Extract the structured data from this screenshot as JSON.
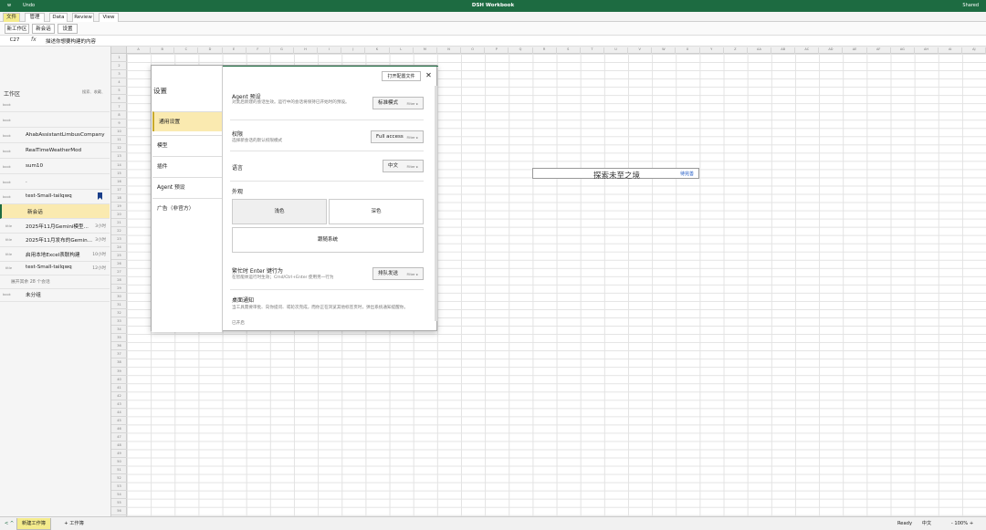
{
  "titlebar": {
    "left": "w",
    "undo": "Undo",
    "title": "DSH Workbook",
    "shared": "Shared"
  },
  "menu": [
    "文件",
    "管理",
    "Data",
    "Review",
    "View"
  ],
  "toolbar": [
    "新工作区",
    "新会话",
    "设置"
  ],
  "formula": {
    "cell": "C27",
    "fx": "fx",
    "text": "描述你想要构建的内容"
  },
  "columns": [
    "A",
    "B",
    "C",
    "D",
    "E",
    "F",
    "G",
    "H",
    "I",
    "J",
    "K",
    "L",
    "M",
    "N",
    "O",
    "P",
    "Q",
    "R",
    "S",
    "T",
    "U",
    "V",
    "W",
    "X",
    "Y",
    "Z",
    "AA",
    "AB",
    "AC",
    "AD",
    "AE",
    "AF",
    "AG",
    "AH",
    "AI",
    "AJ"
  ],
  "sidebar": {
    "title": "工作区",
    "tools": "搜索、收藏、",
    "rows": [
      {
        "icon": "book",
        "name": "",
        "time": ""
      },
      {
        "icon": "book",
        "name": "",
        "time": ""
      },
      {
        "icon": "book",
        "name": "AhabAssistantLimbusCompany",
        "time": ""
      },
      {
        "icon": "book",
        "name": "RealTimeWeatherMod",
        "time": ""
      },
      {
        "icon": "book",
        "name": "sum10",
        "time": ""
      },
      {
        "icon": "book",
        "name": ".",
        "time": ""
      },
      {
        "icon": "book",
        "name": "test-Small-tailqwq",
        "time": ""
      },
      {
        "icon": "",
        "name": "新会话",
        "time": ""
      },
      {
        "icon": "title",
        "name": "2025年11月Gemini模型...",
        "time": "3小时"
      },
      {
        "icon": "title",
        "name": "2025年11月发布的Gemin...",
        "time": "3小时"
      },
      {
        "icon": "title",
        "name": "启用本地Excel表联构建",
        "time": "10小时"
      },
      {
        "icon": "title",
        "name": "test-Small-tailqwq",
        "time": "12小时"
      },
      {
        "icon": "",
        "name": "展开其余 28 个会话",
        "time": ""
      },
      {
        "icon": "book",
        "name": "未分组",
        "time": ""
      }
    ]
  },
  "sheet": {
    "merged_text": "探索未至之境",
    "merged_sub": "待完善"
  },
  "modal": {
    "title": "设置",
    "open_config": "打开配置文件",
    "close": "✕",
    "nav": [
      "通用设置",
      "模型",
      "插件",
      "Agent 预设",
      "广告（非官方）"
    ],
    "agent": {
      "title": "Agent 预设",
      "desc": "对此后新建的会话生效。运行中的会话将保持已开始时的预设。",
      "value": "标准模式",
      "filter": "Filter ▸"
    },
    "perm": {
      "title": "权限",
      "desc": "选择新会话的默认权限模式",
      "value": "Full access",
      "filter": "Filter ▸"
    },
    "lang": {
      "title": "语言",
      "value": "中文",
      "filter": "Filter ▸"
    },
    "appearance": {
      "title": "外观",
      "light": "浅色",
      "dark": "深色",
      "system": "跟随系统"
    },
    "enter": {
      "title": "繁忙时 Enter 键行为",
      "desc": "在智能体运行时生效；Cmd/Ctrl+Enter 使用另一行为",
      "value": "排队发送",
      "filter": "Filter ▸"
    },
    "notify": {
      "title": "桌面通知",
      "desc": "当工具需要审批、向你提问、或轮次完成，而你正在浏览其他标签页时，弹出系统通知提醒你。",
      "state": "已开启"
    }
  },
  "statusbar": {
    "back": "< ^",
    "sheet": "新建工作簿",
    "add": "+ 工作簿",
    "ready": "Ready",
    "lang": "中文",
    "zoom": "- 100% +"
  }
}
